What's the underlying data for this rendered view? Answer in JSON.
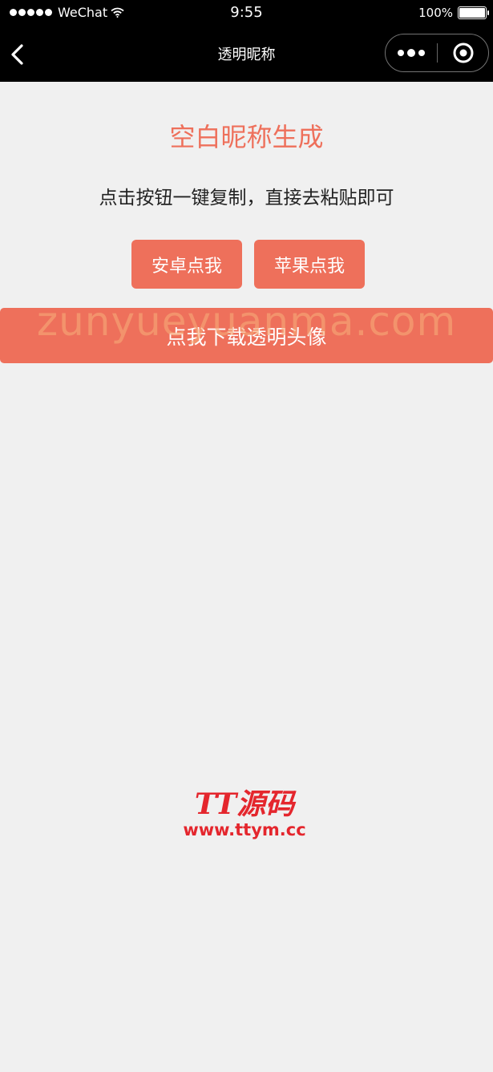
{
  "status_bar": {
    "signal_dots": 5,
    "carrier": "WeChat",
    "time": "9:55",
    "battery_text": "100%",
    "battery_level": 1.0
  },
  "nav": {
    "title": "透明昵称",
    "icons": {
      "back": "chevron-left-icon",
      "more": "more-dots-icon",
      "close": "target-close-icon"
    }
  },
  "main": {
    "title": "空白昵称生成",
    "subtitle": "点击按钮一键复制，直接去粘贴即可",
    "buttons": {
      "android": "安卓点我",
      "apple": "苹果点我",
      "download": "点我下载透明头像"
    }
  },
  "overlays": {
    "watermark_text": "zunyueyuanma.com",
    "logo_main": "TT源码",
    "logo_url": "www.ttym.cc"
  },
  "colors": {
    "accent": "#ee705b",
    "header_bg": "#000000",
    "page_bg": "#f0f0f0",
    "logo_red": "#e4262d",
    "watermark": "#f6aa78"
  }
}
